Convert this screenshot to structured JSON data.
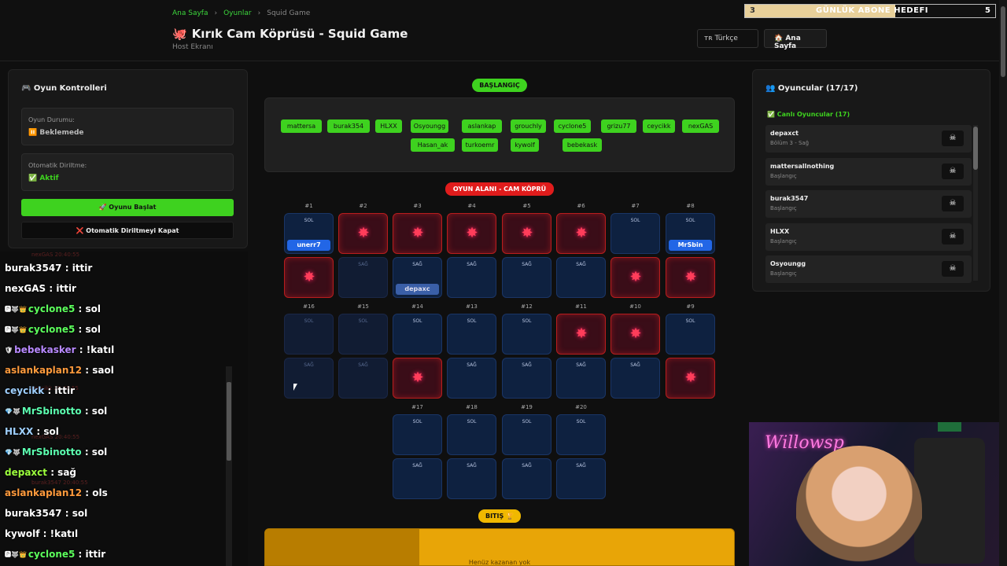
{
  "breadcrumb": {
    "home": "Ana Sayfa",
    "games": "Oyunlar",
    "current": "Squid Game",
    "sep": "›"
  },
  "header": {
    "title": "Kırık Cam Köprüsü - Squid Game",
    "subtitle": "Host Ekranı",
    "title_icon": "octopus-icon"
  },
  "goal": {
    "current": "3",
    "label": "GÜNLÜK ABONE HEDEFI",
    "target": "5",
    "progress": 0.6
  },
  "lang": {
    "label": "ᴛʀ Türkçe"
  },
  "home_button": {
    "label": "🏠 Ana Sayfa"
  },
  "controls": {
    "title": "🎮 Oyun Kontrolleri",
    "status_label": "Oyun Durumu:",
    "status_value": "⏸️ Beklemede",
    "revive_label": "Otomatik Diriltme:",
    "revive_value": "✅ Aktif",
    "start_button": "🚀 Oyunu Başlat",
    "revive_off_button": "❌ Otomatik Diriltmeyi Kapat"
  },
  "chat": [
    {
      "user": "burak3547",
      "msg": "ittir",
      "color": "#ffffff",
      "badges": ""
    },
    {
      "user": "nexGAS",
      "msg": "ittir",
      "color": "#ffffff",
      "badges": ""
    },
    {
      "user": "cyclone5",
      "msg": "sol",
      "color": "#5cff5c",
      "badges": "🅿🐺👑"
    },
    {
      "user": "cyclone5",
      "msg": "sol",
      "color": "#5cff5c",
      "badges": "🅿🐺👑"
    },
    {
      "user": "bebekasker",
      "msg": "!katıl",
      "color": "#b889ff",
      "badges": "🛡"
    },
    {
      "user": "aslankaplan12",
      "msg": "saol",
      "color": "#ff9a3c",
      "badges": ""
    },
    {
      "user": "ceycikk",
      "msg": "ittir",
      "color": "#9fd0ff",
      "badges": ""
    },
    {
      "user": "MrSbinotto",
      "msg": "sol",
      "color": "#5cffb0",
      "badges": "💎🐺"
    },
    {
      "user": "HLXX",
      "msg": "sol",
      "color": "#9fd0ff",
      "badges": ""
    },
    {
      "user": "MrSbinotto",
      "msg": "sol",
      "color": "#5cffb0",
      "badges": "💎🐺"
    },
    {
      "user": "depaxct",
      "msg": "sağ",
      "color": "#9cff3c",
      "badges": ""
    },
    {
      "user": "aslankaplan12",
      "msg": "ols",
      "color": "#ff9a3c",
      "badges": ""
    },
    {
      "user": "burak3547",
      "msg": "sol",
      "color": "#ffffff",
      "badges": ""
    },
    {
      "user": "kywolf",
      "msg": "!katıl",
      "color": "#ffffff",
      "badges": ""
    },
    {
      "user": "cyclone5",
      "msg": "ittir",
      "color": "#5cff5c",
      "badges": "🅿🐺👑"
    }
  ],
  "start_zone": {
    "label": "BAŞLANGIÇ",
    "players": [
      "mattersa",
      "burak354",
      "HLXX",
      "Osyoungg",
      "aslankap",
      "grouchly",
      "cyclone5",
      "grizu77",
      "ceycikk",
      "nexGAS",
      "Hasan_ak",
      "turkoemr",
      "kywolf",
      "bebekask"
    ]
  },
  "bridge": {
    "label": "OYUN ALANI - CAM KÖPRÜ",
    "left_label": "SOL",
    "right_label": "SAĞ",
    "row1": [
      {
        "n": "#1",
        "top": {
          "state": "ok",
          "player": "unerr7"
        },
        "bottom": {
          "state": "broken"
        }
      },
      {
        "n": "#2",
        "top": {
          "state": "broken"
        },
        "bottom": {
          "state": "dim"
        }
      },
      {
        "n": "#3",
        "top": {
          "state": "broken"
        },
        "bottom": {
          "state": "ok",
          "player": "depaxc"
        }
      },
      {
        "n": "#4",
        "top": {
          "state": "broken"
        },
        "bottom": {
          "state": "ok"
        }
      },
      {
        "n": "#5",
        "top": {
          "state": "broken"
        },
        "bottom": {
          "state": "ok"
        }
      },
      {
        "n": "#6",
        "top": {
          "state": "broken"
        },
        "bottom": {
          "state": "ok"
        }
      },
      {
        "n": "#7",
        "top": {
          "state": "ok"
        },
        "bottom": {
          "state": "broken"
        }
      },
      {
        "n": "#8",
        "top": {
          "state": "ok",
          "player": "MrSbin"
        },
        "bottom": {
          "state": "broken"
        }
      }
    ],
    "row2": [
      {
        "n": "#16",
        "top": {
          "state": "dim"
        },
        "bottom": {
          "state": "dim"
        }
      },
      {
        "n": "#15",
        "top": {
          "state": "dim"
        },
        "bottom": {
          "state": "dim"
        }
      },
      {
        "n": "#14",
        "top": {
          "state": "ok"
        },
        "bottom": {
          "state": "broken"
        }
      },
      {
        "n": "#13",
        "top": {
          "state": "ok"
        },
        "bottom": {
          "state": "ok"
        }
      },
      {
        "n": "#12",
        "top": {
          "state": "ok"
        },
        "bottom": {
          "state": "ok"
        }
      },
      {
        "n": "#11",
        "top": {
          "state": "broken"
        },
        "bottom": {
          "state": "ok"
        }
      },
      {
        "n": "#10",
        "top": {
          "state": "broken"
        },
        "bottom": {
          "state": "ok"
        }
      },
      {
        "n": "#9",
        "top": {
          "state": "ok"
        },
        "bottom": {
          "state": "broken"
        }
      }
    ],
    "row3": [
      {
        "n": "#17",
        "top": {
          "state": "ok"
        },
        "bottom": {
          "state": "ok"
        }
      },
      {
        "n": "#18",
        "top": {
          "state": "ok"
        },
        "bottom": {
          "state": "ok"
        }
      },
      {
        "n": "#19",
        "top": {
          "state": "ok"
        },
        "bottom": {
          "state": "ok"
        }
      },
      {
        "n": "#20",
        "top": {
          "state": "ok"
        },
        "bottom": {
          "state": "ok"
        }
      }
    ]
  },
  "end_zone": {
    "label": "BITIŞ 🏆",
    "text": "Henüz kazanan yok"
  },
  "players_panel": {
    "title": "👥 Oyuncular (17/17)",
    "live_label": "✅ Canlı Oyuncular (17)",
    "list": [
      {
        "name": "depaxct",
        "status": "Bölüm 3 - Sağ"
      },
      {
        "name": "mattersallnothing",
        "status": "Başlangıç"
      },
      {
        "name": "burak3547",
        "status": "Başlangıç"
      },
      {
        "name": "HLXX",
        "status": "Başlangıç"
      },
      {
        "name": "Osyoungg",
        "status": "Başlangıç"
      }
    ],
    "kick_icon": "☠"
  },
  "webcam": {
    "overlay_text": "Willowsp"
  },
  "colors": {
    "accent": "#3ed21f",
    "danger": "#e01c1c",
    "tile": "#0e2140",
    "gold": "#e8a507"
  }
}
